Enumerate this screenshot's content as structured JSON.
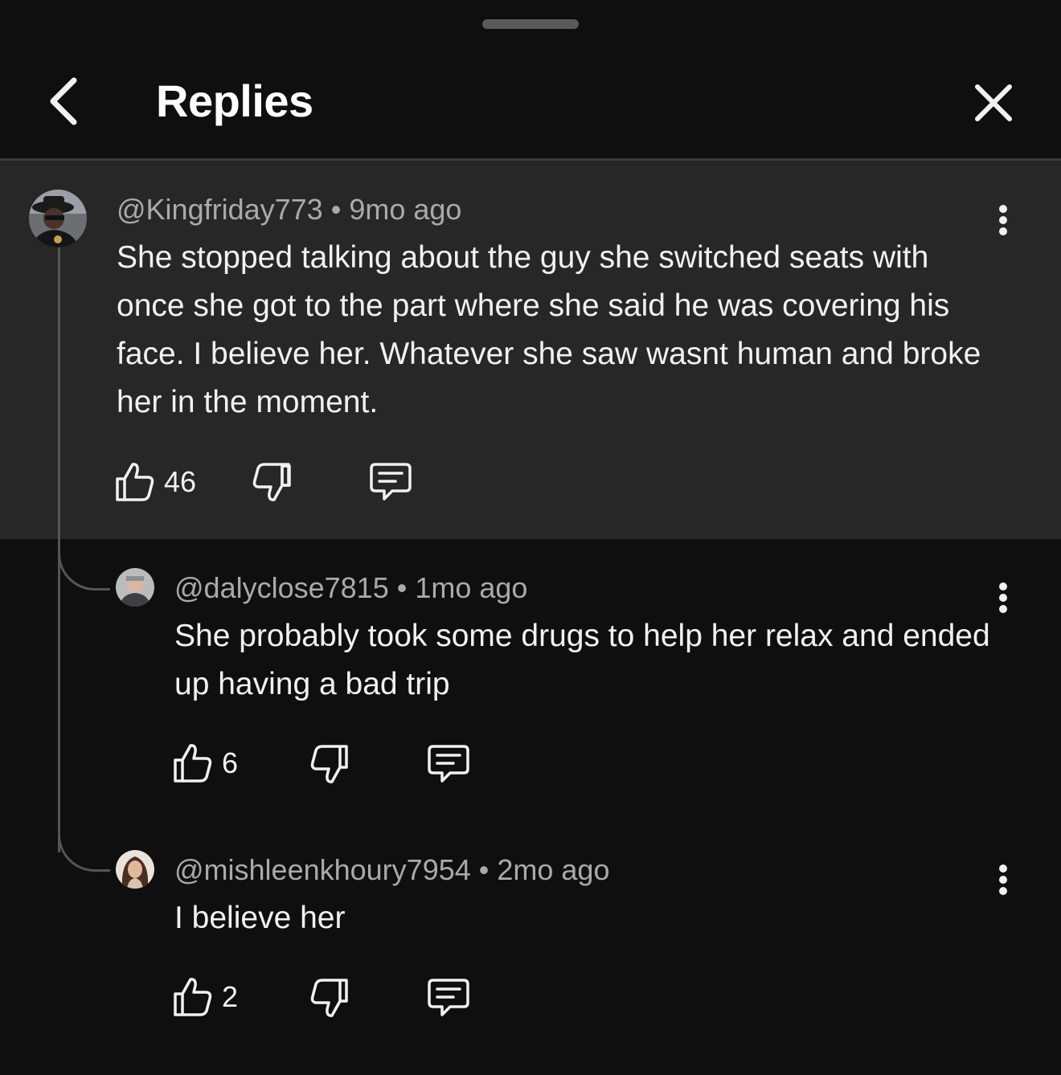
{
  "header": {
    "title": "Replies"
  },
  "main_comment": {
    "author": "@Kingfriday773",
    "time": "9mo ago",
    "separator": "•",
    "text": "She stopped talking about the guy she switched seats with once she got to the part where she said  he was covering his face. I believe her. Whatever she saw wasnt human and broke her in the moment.",
    "likes": "46"
  },
  "replies": [
    {
      "author": "@dalyclose7815",
      "time": "1mo ago",
      "separator": "•",
      "text": "She probably took some drugs to help her relax and ended up having a bad trip",
      "likes": "6"
    },
    {
      "author": "@mishleenkhoury7954",
      "time": "2mo ago",
      "separator": "•",
      "text": "I believe her",
      "likes": "2"
    }
  ],
  "colors": {
    "background": "#0f0f0f",
    "highlight": "#272727",
    "text": "#f1f1f1",
    "secondary": "#aaaaaa"
  },
  "icons": [
    "chevron-left-icon",
    "close-icon",
    "thumbs-up-icon",
    "thumbs-down-icon",
    "reply-icon",
    "more-vertical-icon"
  ]
}
